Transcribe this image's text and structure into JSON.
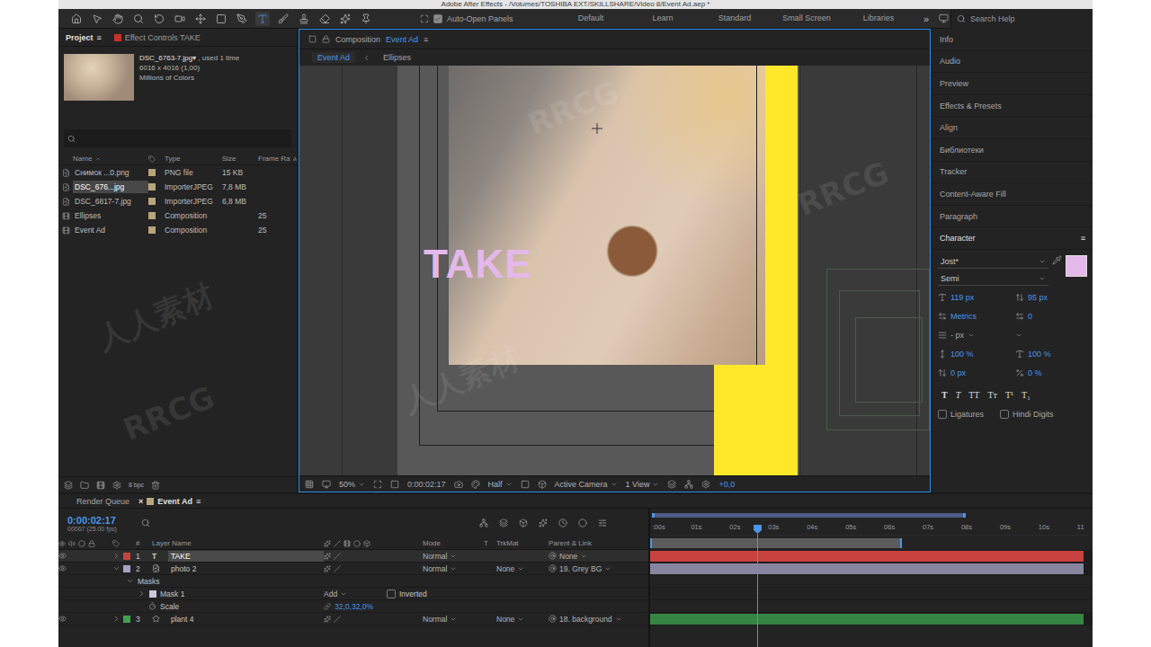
{
  "window": {
    "title": "Adobe After Effects - /Volumes/TOSHIBA EXT/SKILLSHARE/Video 8/Event Ad.aep *"
  },
  "toolbar": {
    "tools": [
      {
        "tool": "home",
        "selected": false
      },
      {
        "tool": "selection",
        "selected": false
      },
      {
        "tool": "hand",
        "selected": false
      },
      {
        "tool": "zoom",
        "selected": false
      },
      {
        "tool": "rotation",
        "selected": false
      },
      {
        "tool": "camera",
        "selected": false
      },
      {
        "tool": "pan-behind",
        "selected": false
      },
      {
        "tool": "rectangle",
        "selected": false
      },
      {
        "tool": "pen",
        "selected": false
      },
      {
        "tool": "type",
        "selected": true
      },
      {
        "tool": "brush",
        "selected": false
      },
      {
        "tool": "clone-stamp",
        "selected": false
      },
      {
        "tool": "eraser",
        "selected": false
      },
      {
        "tool": "roto-brush",
        "selected": false
      },
      {
        "tool": "puppet",
        "selected": false
      }
    ],
    "auto_open": {
      "label": "Auto-Open Panels",
      "checked": true
    },
    "workspaces": [
      {
        "label": "Default",
        "selected": false
      },
      {
        "label": "Learn",
        "selected": false
      },
      {
        "label": "Standard",
        "selected": false
      },
      {
        "label": "Small Screen",
        "selected": false
      },
      {
        "label": "Libraries",
        "selected": false
      }
    ],
    "overflow": "»",
    "search": {
      "placeholder": "Search Help"
    }
  },
  "project": {
    "tabs": [
      {
        "label": "Project",
        "menu": "≡",
        "selected": true
      },
      {
        "label": "Effect Controls TAKE",
        "selected": false,
        "color": "#c8302c"
      }
    ],
    "preview": {
      "name": "DSC_6763-7.jpg",
      "arrow": "▾",
      "usage": " , used 1 time",
      "size": "6016 x 4016 (1,00)",
      "colors": "Millions of Colors"
    },
    "columns": {
      "name": "Name",
      "type": "Type",
      "size": "Size",
      "rate": "Frame Ra"
    },
    "items": [
      {
        "name": "Снимок ...0.png",
        "type": "PNG file",
        "size": "15 KB",
        "rate": "",
        "kind": "file",
        "selected": false
      },
      {
        "name": "DSC_676...jpg",
        "type": "ImporterJPEG",
        "size": "7,8 MB",
        "rate": "",
        "kind": "file",
        "selected": true
      },
      {
        "name": "DSC_6817-7.jpg",
        "type": "ImporterJPEG",
        "size": "6,8 MB",
        "rate": "",
        "kind": "file",
        "selected": false
      },
      {
        "name": "Ellipses",
        "type": "Composition",
        "size": "",
        "rate": "25",
        "kind": "composition",
        "selected": false
      },
      {
        "name": "Event Ad",
        "type": "Composition",
        "size": "",
        "rate": "25",
        "kind": "composition",
        "selected": false
      }
    ],
    "footer": {
      "bpc": "8 bpc"
    }
  },
  "composition": {
    "tab": {
      "prefix": "Composition",
      "name": "Event Ad",
      "menu": "≡"
    },
    "breadcrumbs": [
      {
        "label": "Event Ad",
        "selected": true
      },
      {
        "label": "Ellipses",
        "selected": false
      }
    ],
    "text_layer": "TAKE",
    "bar": {
      "zoom": "50%",
      "time": "0:00:02:17",
      "resolution": "Half",
      "camera": "Active Camera",
      "views": "1 View",
      "exposure": "+0,0"
    }
  },
  "panels": [
    {
      "label": "Info",
      "expanded": false
    },
    {
      "label": "Audio",
      "expanded": false
    },
    {
      "label": "Preview",
      "expanded": false
    },
    {
      "label": "Effects & Presets",
      "expanded": false
    },
    {
      "label": "Align",
      "expanded": false
    },
    {
      "label": "Библиотеки",
      "expanded": false
    },
    {
      "label": "Tracker",
      "expanded": false
    },
    {
      "label": "Content-Aware Fill",
      "expanded": false
    },
    {
      "label": "Paragraph",
      "expanded": false
    },
    {
      "label": "Character",
      "expanded": true,
      "menu": "≡"
    }
  ],
  "character": {
    "font": "Jost*",
    "style": "Semi",
    "fill_color": "#e4b8ea",
    "size": "119 px",
    "leading": "95 px",
    "kerning": "Metrics",
    "tracking": "0",
    "stroke": "- px",
    "vertical_scale": "100 %",
    "horizontal_scale": "100 %",
    "baseline": "0 px",
    "tsume": "0 %",
    "styles": [
      {
        "label": "T",
        "kind": "bold"
      },
      {
        "label": "T",
        "kind": "italic"
      },
      {
        "label": "TT",
        "kind": "caps"
      },
      {
        "label": "Tт",
        "kind": "small-caps"
      },
      {
        "label": "T¹",
        "kind": "super"
      },
      {
        "label": "T₁",
        "kind": "sub"
      }
    ],
    "options": [
      {
        "label": "Ligatures",
        "checked": false
      },
      {
        "label": "Hindi Digits",
        "checked": false
      }
    ]
  },
  "timeline": {
    "tabs": [
      {
        "label": "Render Queue",
        "selected": false
      },
      {
        "label": "Event Ad",
        "selected": true,
        "close": "×",
        "menu": "≡",
        "color": "#b8a67a"
      }
    ],
    "time": "0:00:02:17",
    "frame": "00067 (25.00 fps)",
    "columns": {
      "index": "#",
      "name": "Layer Name",
      "mode": "Mode",
      "t": "T",
      "trkmat": "TrkMat",
      "parent": "Parent & Link"
    },
    "ruler": [
      ":00s",
      "01s",
      "02s",
      "03s",
      "04s",
      "05s",
      "06s",
      "07s",
      "08s",
      "09s",
      "10s",
      "11"
    ],
    "playhead": 0.242,
    "work_area": 0.569,
    "navigator": 0.715,
    "layers": [
      {
        "kind": "layer",
        "index": "1",
        "layer_type": "text",
        "icon_text": "T",
        "name": "TAKE",
        "color": "#c8433f",
        "visible": true,
        "expanded": false,
        "selected": true,
        "mode": "Normal",
        "trkmat": "",
        "parent": "None"
      },
      {
        "kind": "layer",
        "index": "2",
        "layer_type": "footage",
        "name": "photo 2",
        "color": "#a7a3c6",
        "visible": true,
        "expanded": true,
        "selected": false,
        "mode": "Normal",
        "trkmat": "None",
        "parent": "19. Grey BG"
      },
      {
        "kind": "group",
        "name": "Masks",
        "expanded": true
      },
      {
        "kind": "mask",
        "name": "Mask 1",
        "color": "#c9c9d8",
        "expanded": false,
        "mode": "Add",
        "inverted": {
          "label": "Inverted",
          "checked": false
        }
      },
      {
        "kind": "property",
        "name": "Scale",
        "value": "32,0,32,0%"
      },
      {
        "kind": "layer",
        "index": "3",
        "layer_type": "shape",
        "name": "plant 4",
        "color": "#3fa34d",
        "visible": true,
        "expanded": false,
        "selected": false,
        "mode": "Normal",
        "trkmat": "None",
        "parent": "18. background"
      }
    ]
  },
  "watermarks": [
    "人人素材",
    "RRCG",
    "RRCG",
    "人人素材",
    "RRCG"
  ]
}
